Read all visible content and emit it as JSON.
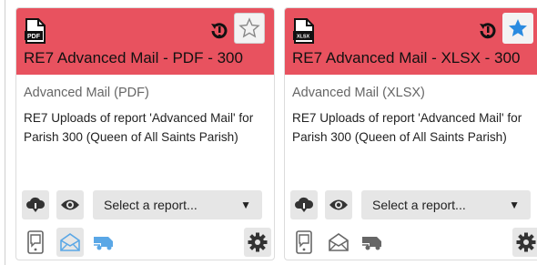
{
  "colors": {
    "header_bg": "#e8525f",
    "star_active": "#2a8be0",
    "star_inactive_bg": "#f3f3f3",
    "email_active": "#5aa7e6"
  },
  "cards": [
    {
      "file_icon": "pdf-file-icon",
      "file_badge": "PDF",
      "title": "RE7 Advanced Mail - PDF - 300",
      "subtitle": "Advanced Mail (PDF)",
      "description": "RE7 Uploads of report 'Advanced Mail' for Parish 300 (Queen of All Saints Parish)",
      "favorite": false,
      "select_placeholder": "Select a report...",
      "email_active": true
    },
    {
      "file_icon": "xlsx-file-icon",
      "file_badge": "XLSX",
      "title": "RE7 Advanced Mail - XLSX - 300",
      "subtitle": "Advanced Mail (XLSX)",
      "description": "RE7 Uploads of report 'Advanced Mail' for Parish 300 (Queen of All Saints Parish)",
      "favorite": true,
      "select_placeholder": "Select a report...",
      "email_active": false
    }
  ]
}
